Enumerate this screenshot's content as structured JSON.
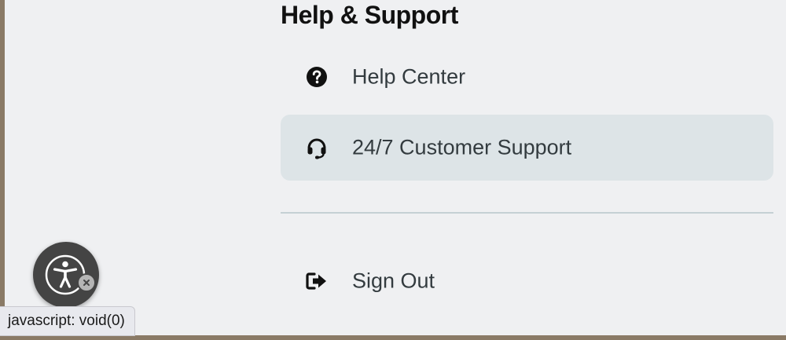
{
  "help_section": {
    "title": "Help & Support",
    "items": [
      {
        "label": "Help Center",
        "icon": "question-circle-icon",
        "active": false
      },
      {
        "label": "24/7 Customer Support",
        "icon": "headset-icon",
        "active": true
      }
    ]
  },
  "sign_out": {
    "label": "Sign Out",
    "icon": "sign-out-icon"
  },
  "accessibility": {
    "icon": "accessibility-icon",
    "close_icon": "close-icon"
  },
  "status_bar": {
    "url": "javascript: void(0)"
  },
  "colors": {
    "page_background": "#eff0f2",
    "active_item_background": "#dde4e7",
    "divider": "#c5d0d4",
    "text": "#333b3f",
    "title": "#111111",
    "accessibility_button": "#444444"
  }
}
